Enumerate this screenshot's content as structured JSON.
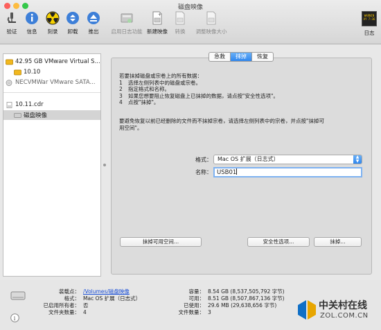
{
  "window": {
    "title": "磁盘映像"
  },
  "colors": {
    "accent": "#2f86ee",
    "close": "#fc605c",
    "minimize": "#fdbc40",
    "zoom": "#34c84a"
  },
  "toolbar": {
    "items": [
      {
        "label": "验证",
        "icon": "microscope-icon"
      },
      {
        "label": "信息",
        "icon": "info-icon"
      },
      {
        "label": "刻录",
        "icon": "burn-icon"
      },
      {
        "label": "卸载",
        "icon": "unmount-icon"
      },
      {
        "label": "推出",
        "icon": "eject-icon"
      },
      {
        "label": "启用日志功能",
        "icon": "journal-icon"
      },
      {
        "label": "新建映像",
        "icon": "new-image-icon"
      },
      {
        "label": "转换",
        "icon": "convert-icon"
      },
      {
        "label": "调整映像大小",
        "icon": "resize-image-icon"
      },
      {
        "label": "日志",
        "icon": "log-icon"
      }
    ],
    "log_screen": "WARNIN\nAY 7:36"
  },
  "sidebar": {
    "items": [
      {
        "label": "42.95 GB VMware Virtual S..."
      },
      {
        "label": "10.10"
      },
      {
        "label": "NECVMWar VMware SATA..."
      },
      {
        "label": "10.11.cdr"
      },
      {
        "label": "磁盘映像"
      }
    ]
  },
  "tabs": [
    {
      "label": "急救"
    },
    {
      "label": "抹掉"
    },
    {
      "label": "恢复"
    }
  ],
  "erase": {
    "intro": "若要抹掉磁盘或宗卷上的所有数据：",
    "steps": [
      {
        "n": "1",
        "text": "选择左侧列表中的磁盘或宗卷。"
      },
      {
        "n": "2",
        "text": "指定格式和名称。"
      },
      {
        "n": "3",
        "text": "如果您想要阻止恢复磁盘上已抹掉的数据，请点按\"安全性选项\"。"
      },
      {
        "n": "4",
        "text": "点按\"抹掉\"。"
      }
    ],
    "note_line1": "要避免恢复以前已经删除的文件而不抹掉宗卷，请选择左侧列表中的宗卷，并点按\"抹掉可",
    "note_line2": "用空间\"。",
    "format_label": "格式：",
    "format_value": "Mac OS 扩展（日志式）",
    "name_label": "名称：",
    "name_value": "USB01",
    "erase_free_space": "抹掉可用空间...",
    "security_options": "安全性选项...",
    "erase_button": "抹掉..."
  },
  "status": {
    "left_keys": [
      "装载点：",
      "格式：",
      "已启用所有者：",
      "文件夹数量："
    ],
    "left_values": [
      "/Volumes/磁盘映像",
      "Mac OS 扩展（日志式）",
      "否",
      "4"
    ],
    "right_keys": [
      "容量：",
      "可用：",
      "已使用：",
      "文件数量："
    ],
    "right_values": [
      "8.54 GB (8,537,505,792 字节)",
      "8.51 GB (8,507,867,136 字节)",
      "29.6 MB (29,638,656 字节)",
      "3"
    ]
  },
  "watermark": {
    "title": "中关村在线",
    "domain": "ZOL.COM.CN"
  }
}
